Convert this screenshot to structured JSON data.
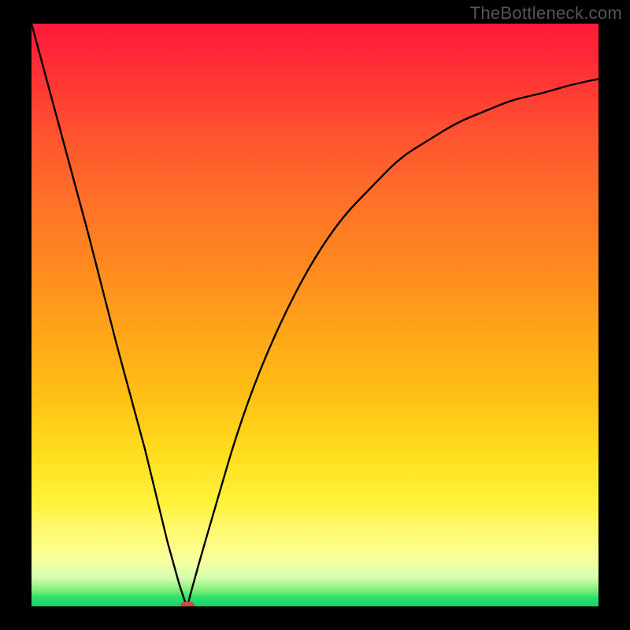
{
  "watermark": "TheBottleneck.com",
  "chart_data": {
    "type": "line",
    "title": "",
    "xlabel": "",
    "ylabel": "",
    "xlim": [
      0,
      100
    ],
    "ylim": [
      0,
      100
    ],
    "grid": false,
    "legend": false,
    "background_gradient": {
      "direction": "vertical",
      "stops": [
        {
          "pos": 0,
          "color": "#ff1a3a",
          "meaning": "high-bottleneck"
        },
        {
          "pos": 50,
          "color": "#ffb31a",
          "meaning": "medium-bottleneck"
        },
        {
          "pos": 85,
          "color": "#fff23a",
          "meaning": "low-bottleneck"
        },
        {
          "pos": 100,
          "color": "#18d16d",
          "meaning": "no-bottleneck"
        }
      ]
    },
    "series": [
      {
        "name": "bottleneck-curve",
        "x": [
          0,
          5,
          10,
          15,
          20,
          22,
          24,
          26,
          27,
          27.5,
          28,
          30,
          33,
          36,
          40,
          45,
          50,
          55,
          60,
          65,
          70,
          75,
          80,
          85,
          90,
          95,
          100
        ],
        "values": [
          100,
          82,
          64,
          45,
          27,
          19,
          11,
          4,
          1,
          0,
          2,
          9,
          19,
          29,
          40,
          51,
          60,
          67,
          72,
          77,
          80,
          83,
          85,
          87,
          88,
          89.5,
          90.5
        ]
      }
    ],
    "markers": [
      {
        "name": "optimal-point",
        "x": 27.5,
        "y": 0,
        "color": "#d1483e"
      }
    ]
  },
  "colors": {
    "curve": "#000000",
    "frame_bg": "#000000",
    "marker": "#d1483e"
  }
}
